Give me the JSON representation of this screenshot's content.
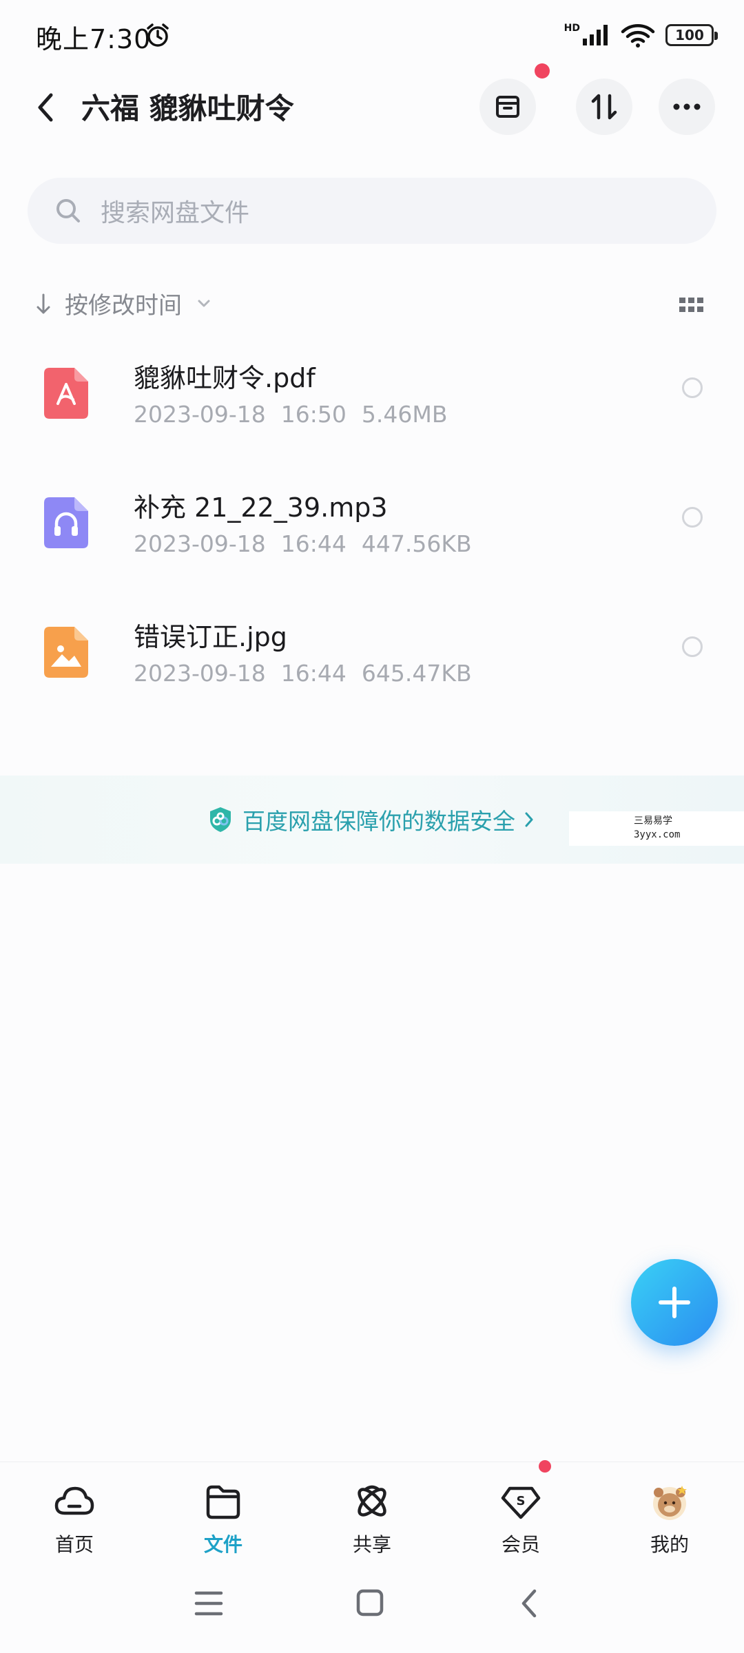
{
  "status_bar": {
    "time": "晚上7:30",
    "network": "HD",
    "battery": "100"
  },
  "header": {
    "title": "六福 貔貅吐财令"
  },
  "search": {
    "placeholder": "搜索网盘文件"
  },
  "sort": {
    "label": "按修改时间"
  },
  "files": [
    {
      "name": "貔貅吐财令.pdf",
      "date": "2023-09-18",
      "time": "16:50",
      "size": "5.46MB",
      "type": "pdf-icon"
    },
    {
      "name": "补充 21_22_39.mp3",
      "date": "2023-09-18",
      "time": "16:44",
      "size": "447.56KB",
      "type": "audio-icon"
    },
    {
      "name": "错误订正.jpg",
      "date": "2023-09-18",
      "time": "16:44",
      "size": "645.47KB",
      "type": "image-icon"
    }
  ],
  "banner": {
    "text": "百度网盘保障你的数据安全"
  },
  "watermark": {
    "line1": "三易易学",
    "line2": "3yyx.com"
  },
  "bottom_nav": [
    {
      "label": "首页",
      "icon": "cloud-home-icon",
      "active": false
    },
    {
      "label": "文件",
      "icon": "folder-icon",
      "active": true
    },
    {
      "label": "共享",
      "icon": "share-atom-icon",
      "active": false
    },
    {
      "label": "会员",
      "icon": "vip-diamond-icon",
      "active": false
    },
    {
      "label": "我的",
      "icon": "avatar",
      "active": false
    }
  ],
  "colors": {
    "accent": "#1ea1c7",
    "badge": "#f0445f",
    "pdf": "#f2636d",
    "audio": "#8e88f5",
    "image": "#f7a04c"
  }
}
